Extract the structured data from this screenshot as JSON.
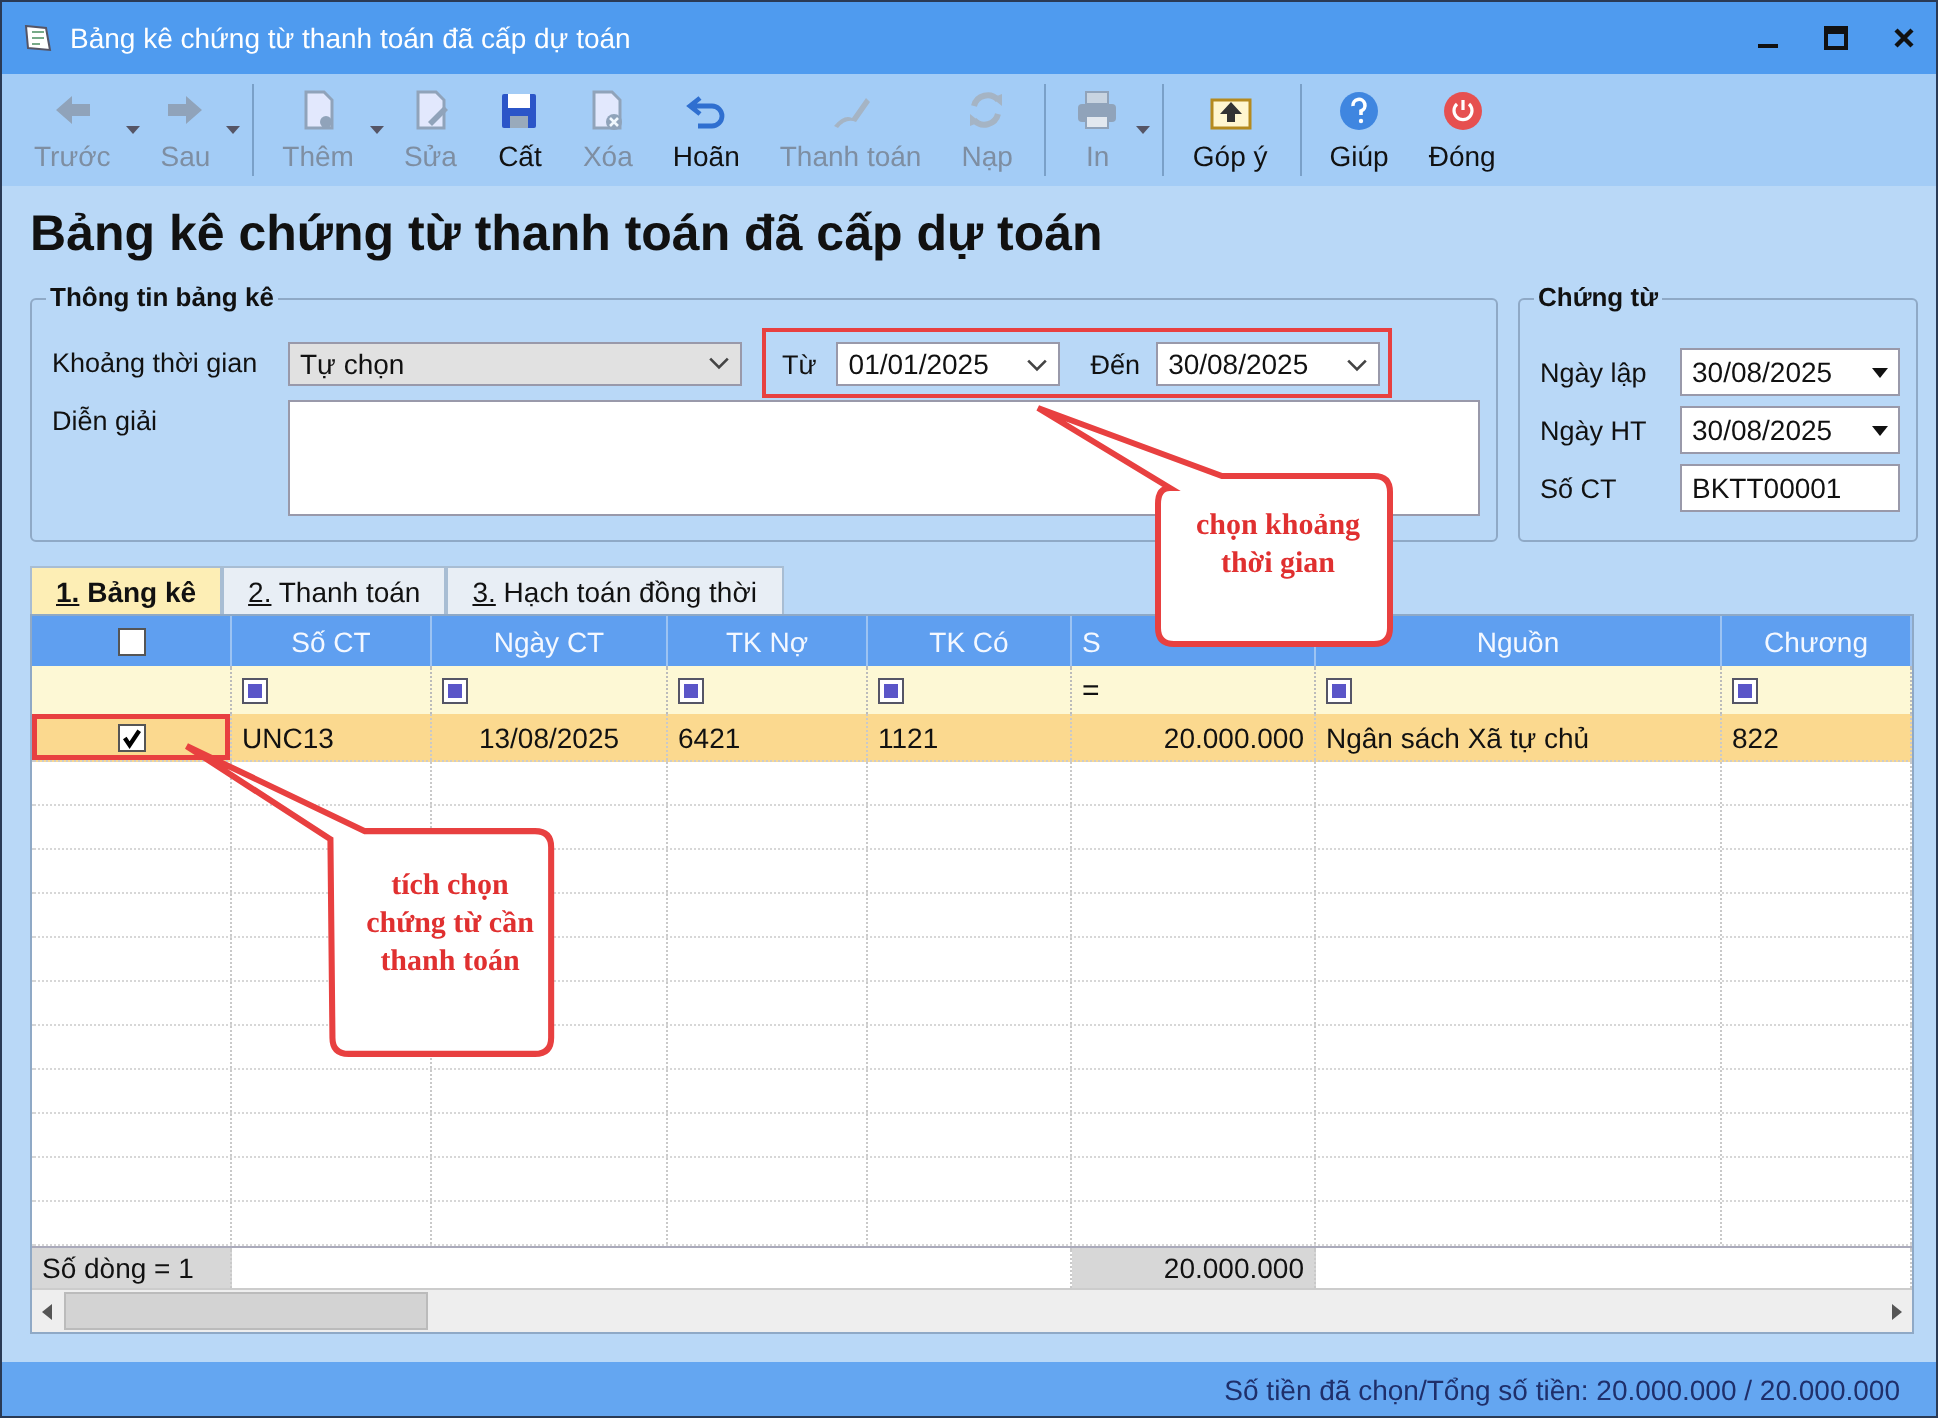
{
  "window": {
    "title": "Bảng kê chứng từ thanh toán đã cấp dự toán"
  },
  "toolbar": [
    {
      "label": "Trước",
      "disabled": true,
      "dropdown": true,
      "group_start": false
    },
    {
      "label": "Sau",
      "disabled": true,
      "dropdown": true,
      "group_start": false
    },
    {
      "label": "Thêm",
      "disabled": true,
      "dropdown": true,
      "group_start": true
    },
    {
      "label": "Sửa",
      "disabled": true,
      "dropdown": false,
      "group_start": false
    },
    {
      "label": "Cất",
      "disabled": false,
      "dropdown": false,
      "group_start": false
    },
    {
      "label": "Xóa",
      "disabled": true,
      "dropdown": false,
      "group_start": false
    },
    {
      "label": "Hoãn",
      "disabled": false,
      "dropdown": false,
      "group_start": false
    },
    {
      "label": "Thanh toán",
      "disabled": true,
      "dropdown": false,
      "group_start": false
    },
    {
      "label": "Nạp",
      "disabled": true,
      "dropdown": false,
      "group_start": false
    },
    {
      "label": "In",
      "disabled": true,
      "dropdown": true,
      "group_start": true
    },
    {
      "label": "Góp ý",
      "disabled": false,
      "dropdown": false,
      "group_start": true
    },
    {
      "label": "Giúp",
      "disabled": false,
      "dropdown": false,
      "group_start": true
    },
    {
      "label": "Đóng",
      "disabled": false,
      "dropdown": false,
      "group_start": false
    }
  ],
  "heading": "Bảng kê chứng từ thanh toán đã cấp dự toán",
  "info": {
    "legend": "Thông tin bảng kê",
    "period_label": "Khoảng thời gian",
    "period_value": "Tự chọn",
    "from_label": "Từ",
    "from_value": "01/01/2025",
    "to_label": "Đến",
    "to_value": "30/08/2025",
    "note_label": "Diễn giải"
  },
  "voucher": {
    "legend": "Chứng từ",
    "fields": [
      {
        "label": "Ngày lập",
        "value": "30/08/2025",
        "kind": "date"
      },
      {
        "label": "Ngày HT",
        "value": "30/08/2025",
        "kind": "date"
      },
      {
        "label": "Số CT",
        "value": "BKTT00001",
        "kind": "text"
      }
    ]
  },
  "tabs": [
    {
      "label": "1. Bảng kê",
      "selected": true
    },
    {
      "label": "2. Thanh toán",
      "selected": false
    },
    {
      "label": "3. Hạch toán đồng thời",
      "selected": false
    }
  ],
  "table": {
    "header_checked": false,
    "columns": [
      {
        "label": "Số CT",
        "filter": {
          "kind": "icon"
        }
      },
      {
        "label": "Ngày CT",
        "filter": {
          "kind": "icon"
        }
      },
      {
        "label": "TK Nợ",
        "filter": {
          "kind": "icon"
        }
      },
      {
        "label": "TK Có",
        "filter": {
          "kind": "icon"
        }
      },
      {
        "label": "S",
        "filter": {
          "kind": "text",
          "text": "="
        }
      },
      {
        "label": "Nguồn",
        "filter": {
          "kind": "icon"
        }
      },
      {
        "label": "Chương",
        "filter": {
          "kind": "icon"
        }
      }
    ],
    "rows": [
      {
        "checked": true,
        "selected": true,
        "cells": [
          "UNC13",
          "13/08/2025",
          "6421",
          "1121",
          "20.000.000",
          "Ngân sách Xã tự chủ",
          "822"
        ]
      }
    ],
    "footer_count": "Số dòng = 1",
    "footer_total": "20.000.000"
  },
  "annotations": [
    "chọn khoảng thời gian",
    "tích chọn chứng từ cần thanh toán"
  ],
  "status_bar": "Số tiền đã chọn/Tổng số tiền: 20.000.000 / 20.000.000"
}
